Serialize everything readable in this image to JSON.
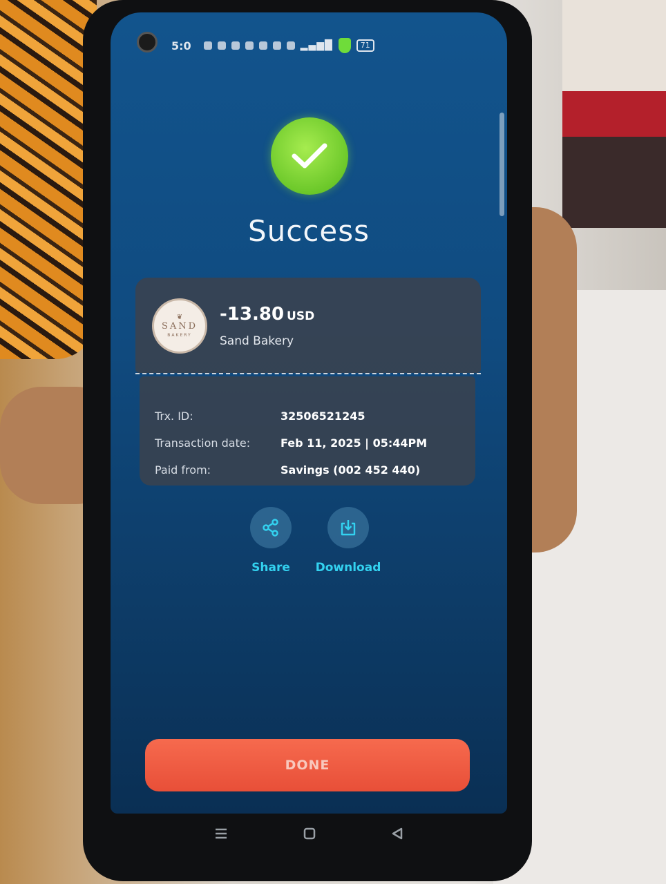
{
  "status_bar": {
    "time": "5:0",
    "battery": "71"
  },
  "result": {
    "title": "Success"
  },
  "transaction": {
    "amount": "-13.80",
    "currency": "USD",
    "merchant": "Sand Bakery",
    "merchant_logo_text": "SAND",
    "merchant_logo_sub": "BAKERY"
  },
  "details": [
    {
      "label": "Trx. ID:",
      "value": "32506521245"
    },
    {
      "label": "Transaction date:",
      "value": "Feb 11, 2025 | 05:44PM"
    },
    {
      "label": "Paid from:",
      "value": "Savings (002 452 440)"
    }
  ],
  "actions": {
    "share_label": "Share",
    "download_label": "Download"
  },
  "done_button": {
    "label": "DONE"
  },
  "colors": {
    "accent_cyan": "#33d2f0",
    "success_green": "#6cc82a",
    "done_orange": "#e84f38",
    "screen_blue": "#104b80"
  }
}
